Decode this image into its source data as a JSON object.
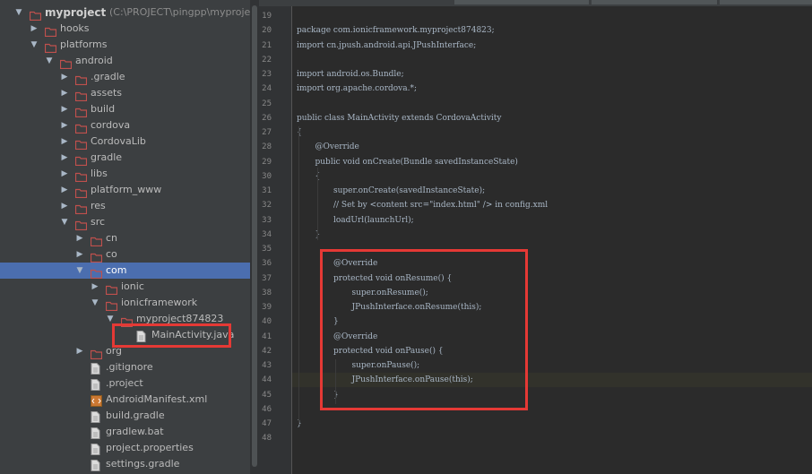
{
  "project_tree": {
    "items": [
      {
        "label": "myproject",
        "path": "(C:\\PROJECT\\pingpp\\myproject)",
        "depth": 0,
        "expanded": true,
        "icon": "folder",
        "bold": true
      },
      {
        "label": "hooks",
        "depth": 1,
        "expanded": false,
        "icon": "folder"
      },
      {
        "label": "platforms",
        "depth": 1,
        "expanded": true,
        "icon": "folder"
      },
      {
        "label": "android",
        "depth": 2,
        "expanded": true,
        "icon": "folder"
      },
      {
        "label": ".gradle",
        "depth": 3,
        "expanded": false,
        "icon": "folder"
      },
      {
        "label": "assets",
        "depth": 3,
        "expanded": false,
        "icon": "folder"
      },
      {
        "label": "build",
        "depth": 3,
        "expanded": false,
        "icon": "folder"
      },
      {
        "label": "cordova",
        "depth": 3,
        "expanded": false,
        "icon": "folder"
      },
      {
        "label": "CordovaLib",
        "depth": 3,
        "expanded": false,
        "icon": "folder"
      },
      {
        "label": "gradle",
        "depth": 3,
        "expanded": false,
        "icon": "folder"
      },
      {
        "label": "libs",
        "depth": 3,
        "expanded": false,
        "icon": "folder"
      },
      {
        "label": "platform_www",
        "depth": 3,
        "expanded": false,
        "icon": "folder"
      },
      {
        "label": "res",
        "depth": 3,
        "expanded": false,
        "icon": "folder"
      },
      {
        "label": "src",
        "depth": 3,
        "expanded": true,
        "icon": "folder"
      },
      {
        "label": "cn",
        "depth": 4,
        "expanded": false,
        "icon": "folder"
      },
      {
        "label": "co",
        "depth": 4,
        "expanded": false,
        "icon": "folder"
      },
      {
        "label": "com",
        "depth": 4,
        "expanded": true,
        "icon": "folder",
        "selected": true
      },
      {
        "label": "ionic",
        "depth": 5,
        "expanded": false,
        "icon": "folder"
      },
      {
        "label": "ionicframework",
        "depth": 5,
        "expanded": true,
        "icon": "folder"
      },
      {
        "label": "myproject874823",
        "depth": 6,
        "expanded": true,
        "icon": "folder"
      },
      {
        "label": "MainActivity.java",
        "depth": 7,
        "icon": "file"
      },
      {
        "label": "org",
        "depth": 4,
        "expanded": false,
        "icon": "folder"
      },
      {
        "label": ".gitignore",
        "depth": 4,
        "icon": "file"
      },
      {
        "label": ".project",
        "depth": 4,
        "icon": "file"
      },
      {
        "label": "AndroidManifest.xml",
        "depth": 4,
        "icon": "xml"
      },
      {
        "label": "build.gradle",
        "depth": 4,
        "icon": "file"
      },
      {
        "label": "gradlew.bat",
        "depth": 4,
        "icon": "file"
      },
      {
        "label": "project.properties",
        "depth": 4,
        "icon": "file"
      },
      {
        "label": "settings.gradle",
        "depth": 4,
        "icon": "file"
      }
    ]
  },
  "editor": {
    "current_line": "44",
    "lines": [
      {
        "num": "19",
        "text": "",
        "indent": 0
      },
      {
        "num": "20",
        "text": "package com.ionicframework.myproject874823;",
        "indent": 0
      },
      {
        "num": "21",
        "text": "import cn.jpush.android.api.JPushInterface;",
        "indent": 0
      },
      {
        "num": "22",
        "text": "",
        "indent": 0
      },
      {
        "num": "23",
        "text": "import android.os.Bundle;",
        "indent": 0
      },
      {
        "num": "24",
        "text": "import org.apache.cordova.*;",
        "indent": 0
      },
      {
        "num": "25",
        "text": "",
        "indent": 0
      },
      {
        "num": "26",
        "text": "public class MainActivity extends CordovaActivity",
        "indent": 0
      },
      {
        "num": "27",
        "text": "{",
        "indent": 0
      },
      {
        "num": "28",
        "text": "@Override",
        "indent": 1
      },
      {
        "num": "29",
        "text": "public void onCreate(Bundle savedInstanceState)",
        "indent": 1
      },
      {
        "num": "30",
        "text": "{",
        "indent": 1
      },
      {
        "num": "31",
        "text": "super.onCreate(savedInstanceState);",
        "indent": 2
      },
      {
        "num": "32",
        "text": "// Set by <content src=\"index.html\" /> in config.xml",
        "indent": 2
      },
      {
        "num": "33",
        "text": "loadUrl(launchUrl);",
        "indent": 2
      },
      {
        "num": "34",
        "text": "}",
        "indent": 1
      },
      {
        "num": "35",
        "text": "",
        "indent": 0
      },
      {
        "num": "36",
        "text": "@Override",
        "indent": 2
      },
      {
        "num": "37",
        "text": "protected void onResume() {",
        "indent": 2
      },
      {
        "num": "38",
        "text": "super.onResume();",
        "indent": 3
      },
      {
        "num": "39",
        "text": "JPushInterface.onResume(this);",
        "indent": 3
      },
      {
        "num": "40",
        "text": "}",
        "indent": 2
      },
      {
        "num": "41",
        "text": "@Override",
        "indent": 2
      },
      {
        "num": "42",
        "text": "protected void onPause() {",
        "indent": 2
      },
      {
        "num": "43",
        "text": "super.onPause();",
        "indent": 3
      },
      {
        "num": "44",
        "text": "JPushInterface.onPause(this);",
        "indent": 3
      },
      {
        "num": "45",
        "text": "}",
        "indent": 2
      },
      {
        "num": "46",
        "text": "",
        "indent": 0
      },
      {
        "num": "47",
        "text": "}",
        "indent": 0
      },
      {
        "num": "48",
        "text": "",
        "indent": 0
      }
    ]
  },
  "colors": {
    "highlight_box": "#e53935",
    "selection": "#4b6eaf",
    "folder": "#c0504d",
    "panel_bg": "#3c3f41",
    "editor_bg": "#2b2b2b"
  }
}
